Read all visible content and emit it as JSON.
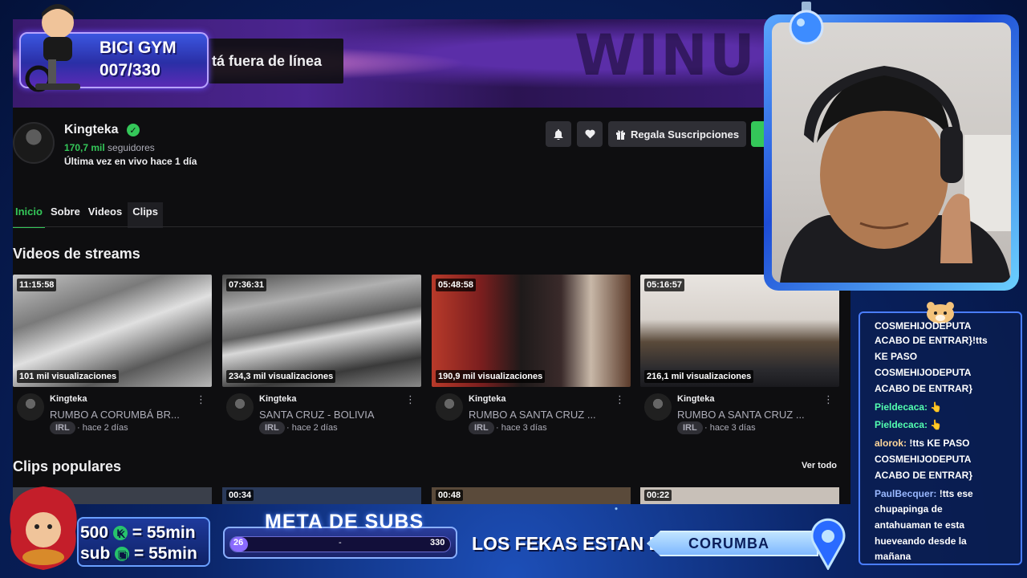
{
  "colors": {
    "accent_green": "#34c759",
    "twitch_bg": "#0e0e10",
    "overlay_blue": "#1d4cd6"
  },
  "channel": {
    "offline_text": "tá fuera de línea",
    "banner_wordmark": "WINU",
    "name": "Kingteka",
    "verified_icon": "check-icon",
    "followers_count": "170,7 mil",
    "followers_label": "seguidores",
    "last_live": "Última vez en vivo hace 1 día",
    "buttons": {
      "notify_icon": "bell-icon",
      "follow_icon": "heart-icon",
      "gift_icon": "gift-icon",
      "gift_label": "Regala Suscripciones"
    }
  },
  "tabs": [
    {
      "label": "Inicio",
      "active": true
    },
    {
      "label": "Sobre",
      "active": false
    },
    {
      "label": "Videos",
      "active": false
    },
    {
      "label": "Clips",
      "active": false
    }
  ],
  "streams": {
    "title": "Videos de streams",
    "items": [
      {
        "duration": "11:15:58",
        "views": "101 mil visualizaciones",
        "channel": "Kingteka",
        "title": "RUMBO A CORUMBÁ BR...",
        "tag": "IRL",
        "age": "· hace 2 días"
      },
      {
        "duration": "07:36:31",
        "views": "234,3 mil visualizaciones",
        "channel": "Kingteka",
        "title": "SANTA CRUZ - BOLIVIA",
        "tag": "IRL",
        "age": "· hace 2 días"
      },
      {
        "duration": "05:48:58",
        "views": "190,9 mil visualizaciones",
        "channel": "Kingteka",
        "title": "RUMBO A SANTA CRUZ ...",
        "tag": "IRL",
        "age": "· hace 3 días"
      },
      {
        "duration": "05:16:57",
        "views": "216,1 mil visualizaciones",
        "channel": "Kingteka",
        "title": "RUMBO A SANTA CRUZ ...",
        "tag": "IRL",
        "age": "· hace 3 días"
      }
    ],
    "more_icon": "more-vertical-icon"
  },
  "clips": {
    "title": "Clips populares",
    "see_all": "Ver todo",
    "durations": [
      "",
      "00:34",
      "00:48",
      "00:22"
    ]
  },
  "overlay": {
    "bici_title": "BICI GYM",
    "bici_count": "007/330",
    "subs_rate_1": "500",
    "subs_rate_1_value": "= 55min",
    "subs_rate_2": "sub",
    "subs_rate_2_value": "= 55min",
    "meta_title": "META DE SUBS",
    "meta_start": "26",
    "meta_mid": "-",
    "meta_end": "330",
    "meta_progress": 0.079,
    "fekas_label": "LOS FEKAS ESTAN EN:",
    "location": "CORUMBA"
  },
  "chat": [
    {
      "user": "",
      "text": "COSMEHIJODEPUTA"
    },
    {
      "user": "",
      "text": "ACABO DE ENTRAR}!tts"
    },
    {
      "user": "",
      "text": "KE PASO"
    },
    {
      "user": "",
      "text": "COSMEHIJODEPUTA"
    },
    {
      "user": "",
      "text": "ACABO DE ENTRAR}"
    },
    {
      "user": "Pieldecaca:",
      "text": " 👆"
    },
    {
      "user": "Pieldecaca:",
      "text": " 👆"
    },
    {
      "user": "alorok:",
      "text": " !tts KE PASO"
    },
    {
      "user": "",
      "text": "COSMEHIJODEPUTA"
    },
    {
      "user": "",
      "text": "ACABO DE ENTRAR}"
    },
    {
      "user": "PaulBecquer:",
      "text": " !tts ese"
    },
    {
      "user": "",
      "text": "chupapinga de"
    },
    {
      "user": "",
      "text": "antahuaman te esta"
    },
    {
      "user": "",
      "text": "hueveando desde la"
    },
    {
      "user": "",
      "text": "mañana"
    }
  ]
}
